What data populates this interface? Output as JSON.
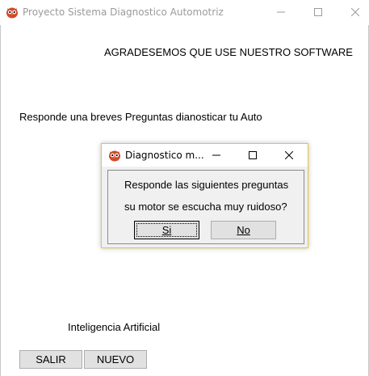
{
  "main_window": {
    "title": "Proyecto Sistema Diagnostico Automotriz",
    "header_text": "AGRADESEMOS QUE USE NUESTRO SOFTWARE",
    "question_text": "Responde una breves Preguntas dianosticar tu Auto",
    "ia_label": "Inteligencia Artificial",
    "buttons": {
      "salir": "SALIR",
      "nuevo": "NUEVO"
    }
  },
  "dialog": {
    "title": "Diagnostico m...",
    "line1": "Responde las siguientes preguntas",
    "line2": "su motor se escucha muy ruidoso?",
    "buttons": {
      "si": "Si",
      "no": "No"
    }
  },
  "colors": {
    "dialog_border": "#e8c63a",
    "button_face": "#e1e1e1",
    "title_inactive": "#9a9a9a"
  },
  "icons": [
    "owl-app-icon",
    "minimize-icon",
    "maximize-icon",
    "close-icon"
  ]
}
